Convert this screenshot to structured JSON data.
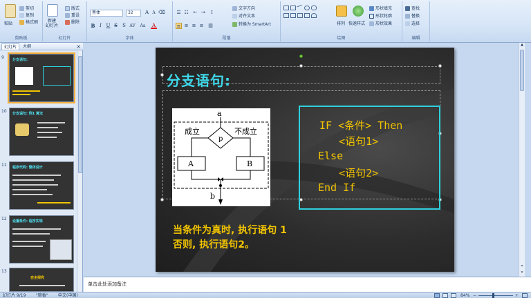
{
  "ribbon": {
    "clipboard": {
      "paste": "粘贴",
      "cut": "剪切",
      "copy": "复制",
      "format_painter": "格式刷",
      "label": "剪贴板"
    },
    "slides": {
      "new_slide": "新建\n幻灯片",
      "layout": "版式",
      "reset": "重设",
      "delete": "删除",
      "label": "幻灯片"
    },
    "font": {
      "font_name": "黑体",
      "font_size": "32",
      "label": "字体"
    },
    "paragraph": {
      "text_direction": "文字方向",
      "align_text": "对齐文本",
      "smartart": "转换为 SmartArt",
      "label": "段落"
    },
    "drawing": {
      "arrange": "排列",
      "quick_styles": "快速样式",
      "shape_fill": "形状填充",
      "shape_outline": "形状轮廓",
      "shape_effects": "形状效果",
      "label": "绘图"
    },
    "editing": {
      "find": "查找",
      "replace": "替换",
      "select": "选择",
      "label": "编辑"
    }
  },
  "left_panel": {
    "tabs": [
      "幻灯片",
      "大纲"
    ],
    "thumbnails": [
      {
        "num": "9",
        "title": "分支语句:"
      },
      {
        "num": "10",
        "title": "分支语句: 例1 算法"
      },
      {
        "num": "11",
        "title": "程序代码: 整体设计"
      },
      {
        "num": "12",
        "title": "设置条件: 程序实现"
      },
      {
        "num": "13",
        "title": "自主探究"
      }
    ]
  },
  "slide": {
    "title": "分支语句:",
    "flowchart": {
      "top": "a",
      "left": "成立",
      "right": "不成立",
      "cond": "p",
      "box_a": "A",
      "box_b": "B",
      "bottom": "b"
    },
    "code": [
      "IF <条件> Then",
      "    <语句1>",
      "Else",
      "    <语句2>",
      "End If"
    ],
    "caption": [
      "当条件为真时, 执行语句 1",
      "否则, 执行语句2。"
    ]
  },
  "notes": {
    "placeholder": "单击此处添加备注"
  },
  "status": {
    "slide_info": "幻灯片 9/19",
    "theme": "\"暗香\"",
    "language": "中文(中国)",
    "zoom": "84%"
  },
  "colors": {
    "accent_cyan": "#3fd8ea",
    "code_yellow": "#f2c400",
    "slide_bg": "#2c2c2c"
  }
}
